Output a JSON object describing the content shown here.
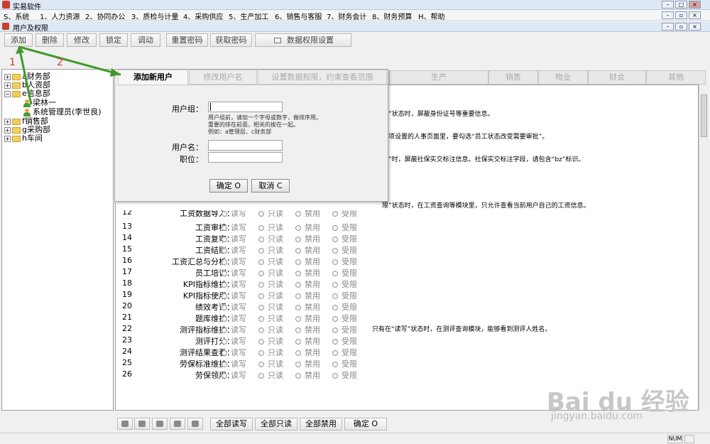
{
  "window": {
    "title": "实易软件"
  },
  "menu": [
    "S、系统",
    "1、人力资源",
    "2、协同办公",
    "3、质检与计量",
    "4、采购供应",
    "5、生产加工",
    "6、销售与客服",
    "7、财务会计",
    "8、财务预算",
    "H、帮助"
  ],
  "subwindow": {
    "title": "用户及权限"
  },
  "toolbar": [
    "添加",
    "删除",
    "修改",
    "锁定",
    "调动",
    "重置密码",
    "获取密码",
    "数据权限设置"
  ],
  "annotations": {
    "one": "1",
    "two": "2"
  },
  "tree": [
    {
      "label": "a财务部",
      "expander": "+"
    },
    {
      "label": "b人资部",
      "expander": "+"
    },
    {
      "label": "e信息部",
      "expander": "−"
    },
    {
      "label": "梁林一"
    },
    {
      "label": "系统管理员(李世良)"
    },
    {
      "label": "f销售部",
      "expander": "+"
    },
    {
      "label": "g采购部",
      "expander": "+"
    },
    {
      "label": "h车间",
      "expander": "+"
    }
  ],
  "module_tabs": [
    "生产",
    "销售",
    "物业",
    "财会",
    "其他"
  ],
  "grid_notes": [
    "限”状态时，屏蔽身份证号等重要信息。",
    "选项设置的人事页面里，要勾选“员工状态改变需要审批”。",
    "限”时，屏蔽社保实交标注信息。社保实交标注字段，请包含“bz”标识。",
    "限”状态时，在工资查询等模块里，只允许查看当前用户自己的工资信息。"
  ],
  "partial_row": {
    "num": "12",
    "label": "工资数据导入："
  },
  "options": [
    "读写",
    "只读",
    "禁用",
    "受限"
  ],
  "rows": [
    {
      "num": "13",
      "label": "工资审核：",
      "note": ""
    },
    {
      "num": "14",
      "label": "工资复审：",
      "note": ""
    },
    {
      "num": "15",
      "label": "工资结账：",
      "note": ""
    },
    {
      "num": "16",
      "label": "工资汇总与分析：",
      "note": ""
    },
    {
      "num": "17",
      "label": "员工培训：",
      "note": ""
    },
    {
      "num": "18",
      "label": "KPI指标维护：",
      "note": ""
    },
    {
      "num": "19",
      "label": "KPI指标使用：",
      "note": ""
    },
    {
      "num": "20",
      "label": "绩效考评：",
      "note": ""
    },
    {
      "num": "21",
      "label": "题库维护：",
      "note": ""
    },
    {
      "num": "22",
      "label": "测评指标维护：",
      "note": "只有在“读写”状态时，在测评查询模块，能够看到测评人姓名。"
    },
    {
      "num": "23",
      "label": "测评打分：",
      "note": ""
    },
    {
      "num": "24",
      "label": "测评结果查看：",
      "note": ""
    },
    {
      "num": "25",
      "label": "劳保标准维护：",
      "note": ""
    },
    {
      "num": "26",
      "label": "劳保领用：",
      "note": ""
    }
  ],
  "dialog": {
    "tabs": [
      "添加新用户",
      "修改用户名",
      "设置数据权限，约束查看范围"
    ],
    "group_label": "用户组：",
    "hint1": "用户组前，请加一个字母或数字，做排序用。",
    "hint2": "重要的排在前面，相关的挨在一起。",
    "hint3": "例如：a管理层、c财务部",
    "username_label": "用户名：",
    "position_label": "职位：",
    "ok": "确定 O",
    "cancel": "取消 C"
  },
  "bottom_buttons": [
    "全部读写",
    "全部只读",
    "全部禁用",
    "确定 O"
  ],
  "status": {
    "num": "NUM"
  },
  "watermark": {
    "logo": "Bai du 经验",
    "url": "jingyan.baidu.com"
  }
}
